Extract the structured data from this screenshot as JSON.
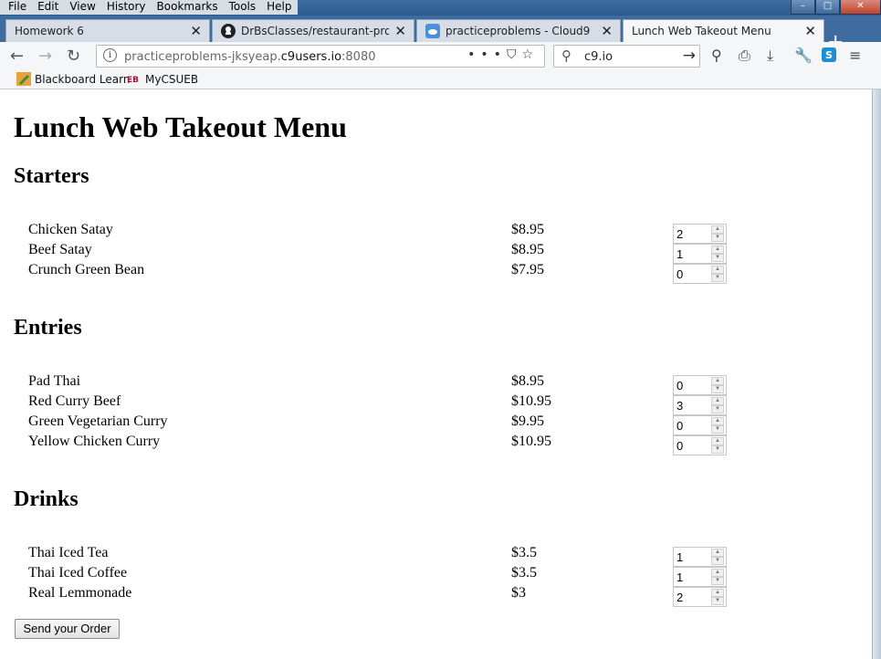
{
  "menu": [
    "File",
    "Edit",
    "View",
    "History",
    "Bookmarks",
    "Tools",
    "Help"
  ],
  "window_controls": {
    "minimize": "–",
    "maximize": "□",
    "close": "✕"
  },
  "tabs": [
    {
      "label": "Homework 6",
      "icon": "none"
    },
    {
      "label": "DrBsClasses/restaurant-project",
      "icon": "github-icon"
    },
    {
      "label": "practiceproblems - Cloud9",
      "icon": "cloud9-icon"
    },
    {
      "label": "Lunch Web Takeout Menu",
      "icon": "none",
      "active": true
    }
  ],
  "address_bar": {
    "url_prefix": "practiceproblems-jksyeap.",
    "url_domain": "c9users.io",
    "url_port": ":8080"
  },
  "search_bar": {
    "value": "c9.io"
  },
  "bookmarks": [
    {
      "label": "Blackboard Learn",
      "icon": "blackboard-icon"
    },
    {
      "label": "MyCSUEB",
      "icon": "eb-icon"
    }
  ],
  "page": {
    "title": "Lunch Web Takeout Menu",
    "sections": [
      {
        "heading": "Starters",
        "items": [
          {
            "name": "Chicken Satay",
            "price": "$8.95",
            "qty": "2"
          },
          {
            "name": "Beef Satay",
            "price": "$8.95",
            "qty": "1"
          },
          {
            "name": "Crunch Green Bean",
            "price": "$7.95",
            "qty": "0"
          }
        ]
      },
      {
        "heading": "Entries",
        "items": [
          {
            "name": "Pad Thai",
            "price": "$8.95",
            "qty": "0"
          },
          {
            "name": "Red Curry Beef",
            "price": "$10.95",
            "qty": "3"
          },
          {
            "name": "Green Vegetarian Curry",
            "price": "$9.95",
            "qty": "0"
          },
          {
            "name": "Yellow Chicken Curry",
            "price": "$10.95",
            "qty": "0"
          }
        ]
      },
      {
        "heading": "Drinks",
        "items": [
          {
            "name": "Thai Iced Tea",
            "price": "$3.5",
            "qty": "1"
          },
          {
            "name": "Thai Iced Coffee",
            "price": "$3.5",
            "qty": "1"
          },
          {
            "name": "Real Lemmonade",
            "price": "$3",
            "qty": "2"
          }
        ]
      }
    ],
    "submit_label": "Send your Order"
  }
}
